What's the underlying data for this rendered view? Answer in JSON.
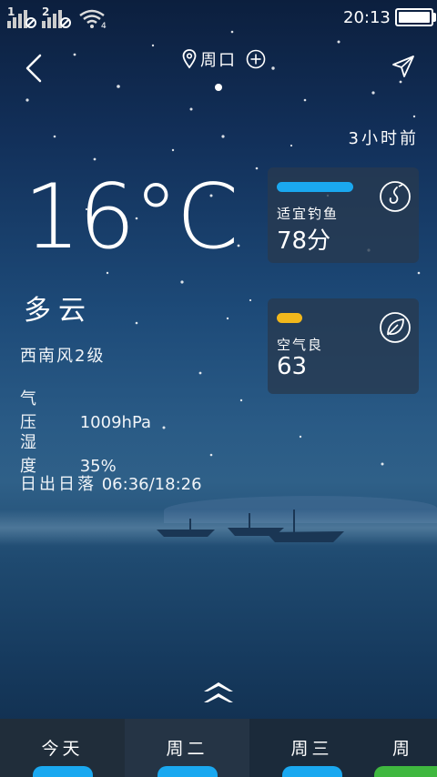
{
  "status_bar": {
    "sim1": "1",
    "sim2": "2",
    "time": "20:13",
    "wifi_label": "4",
    "battery_level": 1.0
  },
  "header": {
    "location": "周口",
    "icons": {
      "back": "chevron-left-icon",
      "pin": "map-pin-icon",
      "add": "plus-circle-icon",
      "share": "send-icon"
    }
  },
  "update_time": "3小时前",
  "weather": {
    "temperature": "16°C",
    "condition": "多云",
    "wind": "西南风2级",
    "pressure_label": "气压",
    "pressure_value": "1009hPa",
    "humidity_label": "湿度",
    "humidity_value": "35%",
    "sun_label": "日出日落",
    "sun_value": "06:36/18:26"
  },
  "cards": {
    "fishing": {
      "label": "适宜钓鱼",
      "value": "78分",
      "bar_color": "#1aa8f0",
      "icon": "fishing-hook-icon"
    },
    "air": {
      "label": "空气良",
      "value": "63",
      "bar_color": "#f2b81c",
      "icon": "leaf-icon"
    }
  },
  "tabs": [
    {
      "label": "今天",
      "indicator_color": "#1aa8f0"
    },
    {
      "label": "周二",
      "indicator_color": "#1aa8f0"
    },
    {
      "label": "周三",
      "indicator_color": "#1aa8f0"
    },
    {
      "label": "周",
      "indicator_color": "#3fb83f"
    }
  ]
}
